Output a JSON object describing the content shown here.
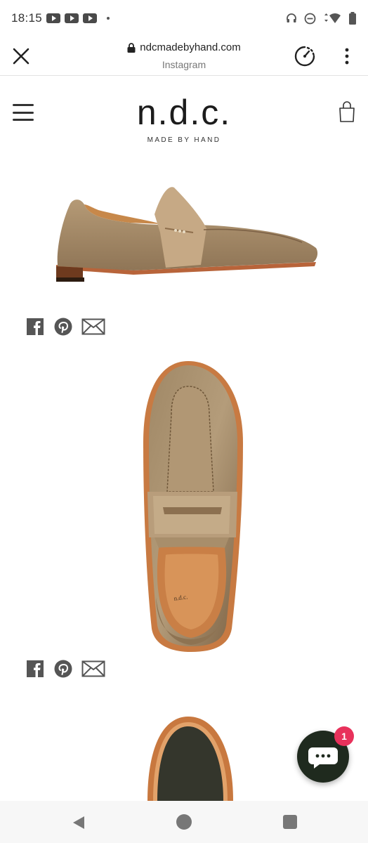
{
  "status_bar": {
    "time": "18:15",
    "notification_icons": [
      "youtube-icon",
      "youtube-icon",
      "youtube-icon",
      "dot-icon"
    ],
    "right_icons": [
      "headset-icon",
      "do-not-disturb-icon",
      "wifi-icon",
      "battery-icon"
    ]
  },
  "browser": {
    "url": "ndcmadebyhand.com",
    "source": "Instagram"
  },
  "site": {
    "logo": "n.d.c.",
    "tagline": "MADE BY HAND"
  },
  "products": [
    {
      "view": "side",
      "share_icons": [
        "facebook-icon",
        "pinterest-icon",
        "email-icon"
      ]
    },
    {
      "view": "top",
      "share_icons": [
        "facebook-icon",
        "pinterest-icon",
        "email-icon"
      ]
    },
    {
      "view": "sole"
    }
  ],
  "chat": {
    "badge_count": "1"
  },
  "colors": {
    "suede": "#a98d6a",
    "leather_sole": "#b8643a",
    "chat_bg": "#1f2a1e",
    "badge": "#e8315b"
  }
}
